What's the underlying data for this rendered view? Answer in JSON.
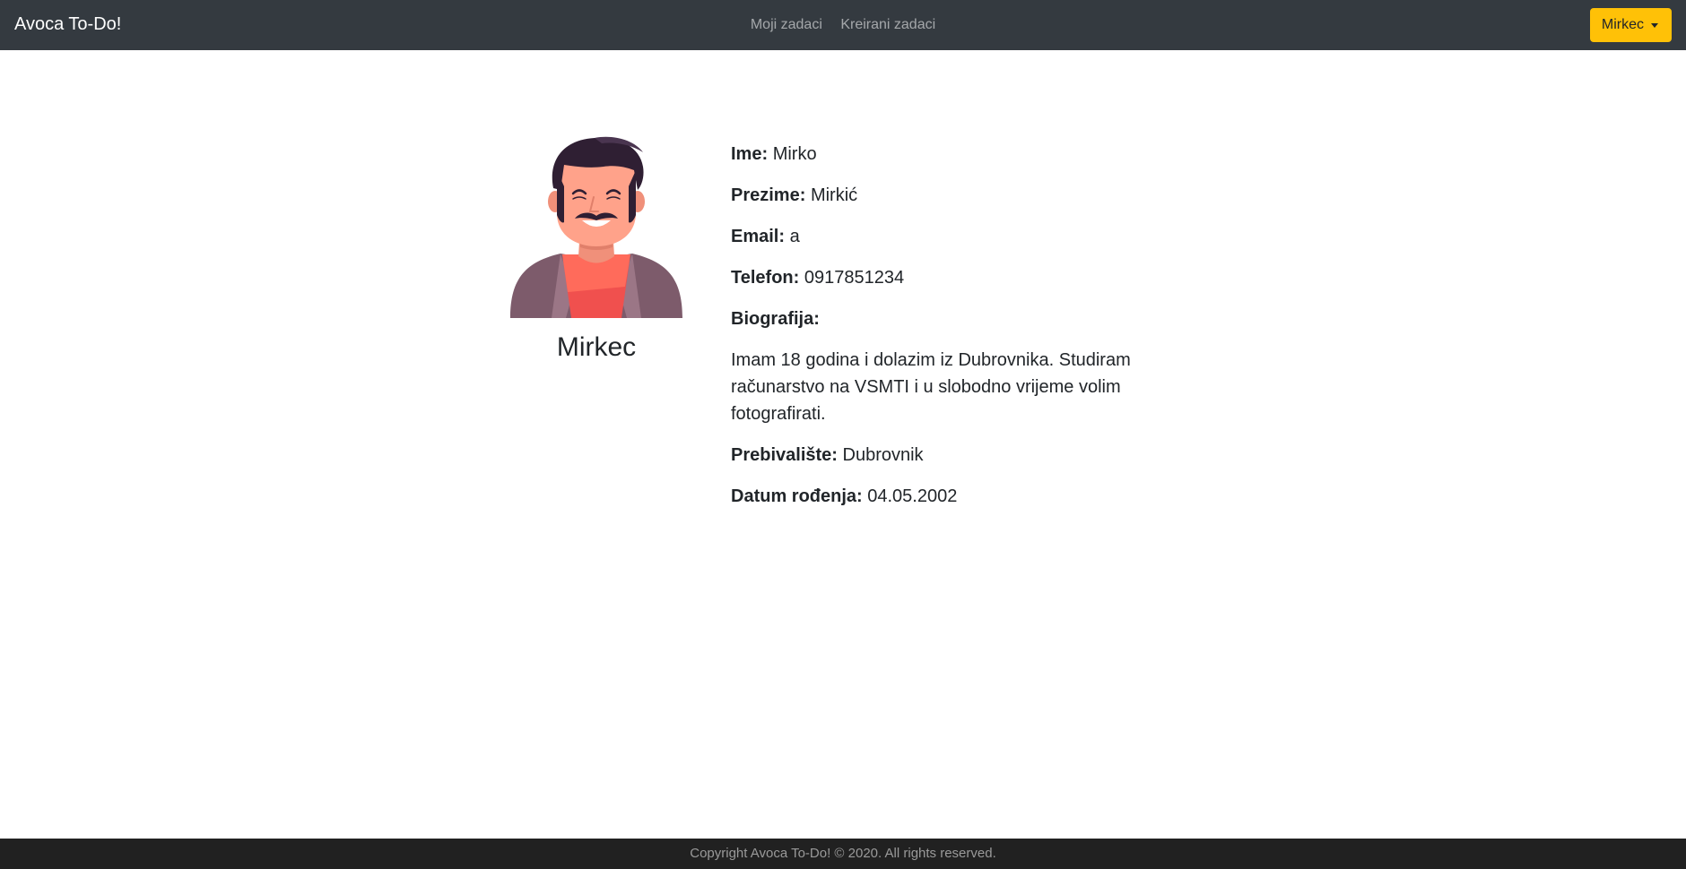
{
  "navbar": {
    "brand": "Avoca To-Do!",
    "links": [
      {
        "label": "Moji zadaci"
      },
      {
        "label": "Kreirani zadaci"
      }
    ],
    "user_button": "Mirkec",
    "brand_color": "#343a40",
    "accent_color": "#ffc107"
  },
  "profile": {
    "avatar_icon": "man-avatar-illustration",
    "username": "Mirkec",
    "fields": {
      "ime_label": "Ime:",
      "ime_value": "Mirko",
      "prezime_label": "Prezime:",
      "prezime_value": "Mirkić",
      "email_label": "Email:",
      "email_value": "a",
      "telefon_label": "Telefon:",
      "telefon_value": "0917851234",
      "biografija_label": "Biografija:",
      "biografija_value": "Imam 18 godina i dolazim iz Dubrovnika. Studiram računarstvo na VSMTI i u slobodno vrijeme volim fotografirati.",
      "prebivaliste_label": "Prebivalište:",
      "prebivaliste_value": "Dubrovnik",
      "datum_label": "Datum rođenja:",
      "datum_value": "04.05.2002"
    }
  },
  "footer": {
    "text": "Copyright Avoca To-Do! © 2020. All rights reserved."
  }
}
